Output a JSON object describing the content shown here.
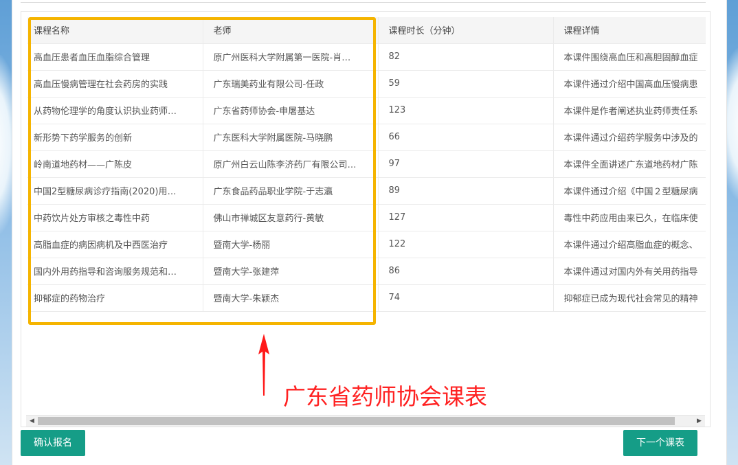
{
  "table": {
    "headers": [
      "课程名称",
      "老师",
      "课程时长（分钟）",
      "课程详情"
    ],
    "rows": [
      {
        "name": "高血压患者血压血脂综合管理",
        "teacher": "原广州医科大学附属第一医院-肖…",
        "duration": "82",
        "detail": "本课件围绕高血压和高胆固醇血症"
      },
      {
        "name": "高血压慢病管理在社会药房的实践",
        "teacher": "广东瑞美药业有限公司-任政",
        "duration": "59",
        "detail": "本课件通过介绍中国高血压慢病患"
      },
      {
        "name": "从药物伦理学的角度认识执业药师…",
        "teacher": "广东省药师协会-申屠基达",
        "duration": "123",
        "detail": "本课件是作者阐述执业药师责任系"
      },
      {
        "name": "新形势下药学服务的创新",
        "teacher": "广东医科大学附属医院-马晓鹏",
        "duration": "66",
        "detail": "本课件通过介绍药学服务中涉及的"
      },
      {
        "name": "岭南道地药材——广陈皮",
        "teacher": "原广州白云山陈李济药厂有限公司…",
        "duration": "97",
        "detail": "本课件全面讲述广东道地药材广陈"
      },
      {
        "name": "中国2型糖尿病诊疗指南(2020)用…",
        "teacher": "广东食品药品职业学院-于志瀛",
        "duration": "89",
        "detail": "本课件通过介绍《中国２型糖尿病"
      },
      {
        "name": "中药饮片处方审核之毒性中药",
        "teacher": "佛山市禅城区友意药行-黄敏",
        "duration": "127",
        "detail": "毒性中药应用由来已久，在临床使"
      },
      {
        "name": "高脂血症的病因病机及中西医治疗",
        "teacher": "暨南大学-杨丽",
        "duration": "122",
        "detail": "本课件通过介绍高脂血症的概念、"
      },
      {
        "name": "国内外用药指导和咨询服务规范和…",
        "teacher": "暨南大学-张建萍",
        "duration": "86",
        "detail": "本课件通过对国内外有关用药指导"
      },
      {
        "name": "抑郁症的药物治疗",
        "teacher": "暨南大学-朱颖杰",
        "duration": "74",
        "detail": "抑郁症已成为现代社会常见的精神"
      }
    ]
  },
  "annotation": {
    "text": "广东省药师协会课表",
    "color": "#ff2222",
    "highlight_color": "#f5b400"
  },
  "scrollbar": {
    "left_arrow": "◀",
    "right_arrow": "▶"
  },
  "buttons": {
    "confirm_label": "确认报名",
    "next_label": "下一个课表",
    "color": "#159d87"
  }
}
